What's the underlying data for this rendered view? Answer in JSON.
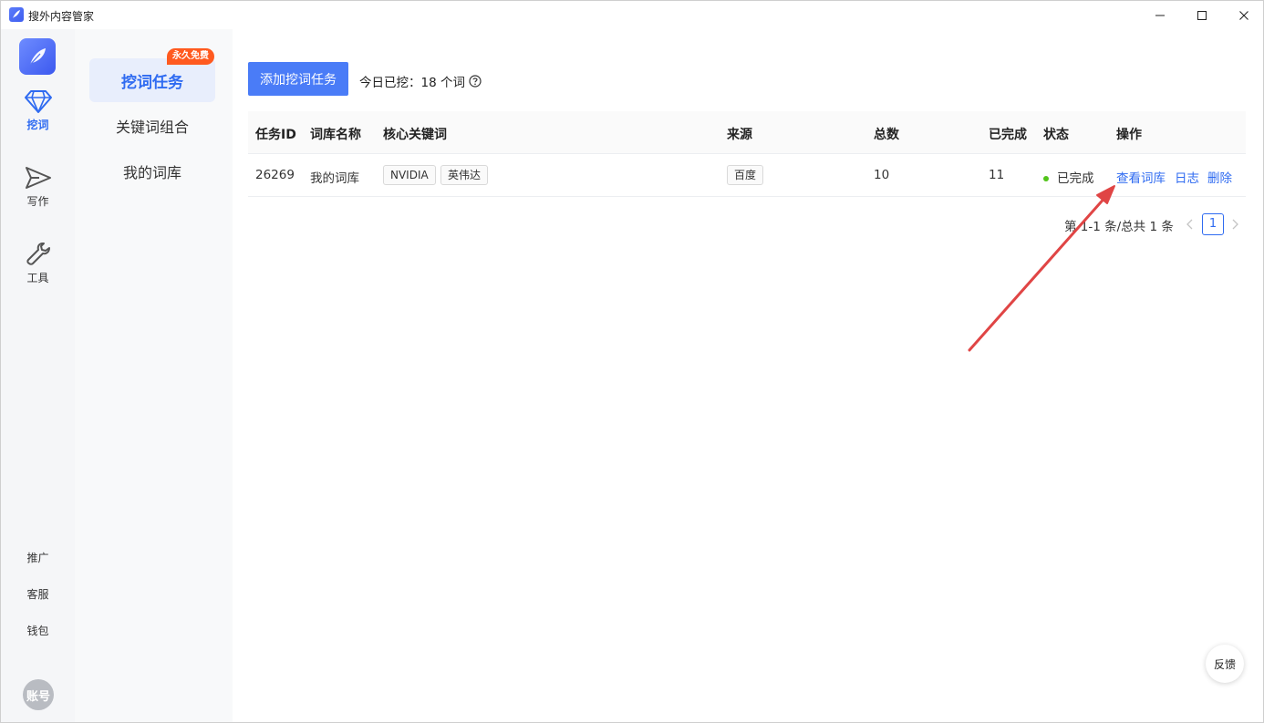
{
  "window": {
    "title": "搜外内容管家"
  },
  "rail": {
    "items": [
      {
        "label": "挖词",
        "icon": "diamond-icon",
        "active": true
      },
      {
        "label": "写作",
        "icon": "send-icon",
        "active": false
      },
      {
        "label": "工具",
        "icon": "wrench-icon",
        "active": false
      }
    ],
    "bottom_links": [
      "推广",
      "客服",
      "钱包"
    ],
    "account": "账号"
  },
  "submenu": {
    "badge": "永久免费",
    "items": [
      {
        "label": "挖词任务",
        "active": true
      },
      {
        "label": "关键词组合",
        "active": false
      },
      {
        "label": "我的词库",
        "active": false
      }
    ]
  },
  "toolbar": {
    "add_button": "添加挖词任务",
    "today_label": "今日已挖：",
    "today_value": "18 个词"
  },
  "table": {
    "headers": [
      "任务ID",
      "词库名称",
      "核心关键词",
      "来源",
      "总数",
      "已完成",
      "状态",
      "操作"
    ],
    "rows": [
      {
        "id": "26269",
        "library": "我的词库",
        "keywords": [
          "NVIDIA",
          "英伟达"
        ],
        "source": "百度",
        "total": "10",
        "done": "11",
        "status": "已完成",
        "actions": [
          "查看词库",
          "日志",
          "删除"
        ]
      }
    ]
  },
  "pagination": {
    "summary": "第 1-1 条/总共 1 条",
    "current_page": "1"
  },
  "feedback": "反馈",
  "colors": {
    "primary": "#4a7cf7",
    "link": "#2f6bf1",
    "badge": "#ff5a1f",
    "status_ok": "#52c41a",
    "annotation_arrow": "#e04545"
  }
}
